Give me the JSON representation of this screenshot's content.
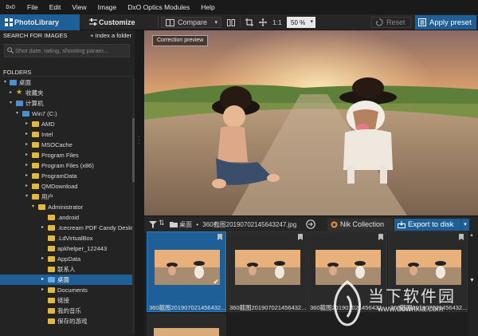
{
  "menubar": {
    "logo": "DxO",
    "items": [
      "File",
      "Edit",
      "View",
      "Image",
      "DxO Optics Modules",
      "Help"
    ]
  },
  "toolbar": {
    "tab_photolibrary": "PhotoLibrary",
    "tab_customize": "Customize",
    "compare": "Compare",
    "zoom_one": "1:1",
    "zoom_value": "50 %",
    "reset": "Reset",
    "apply_preset": "Apply preset"
  },
  "left": {
    "search_header": "SEARCH FOR IMAGES",
    "index_folder": "+ Index a folder",
    "search_placeholder": "Shot date, rating, shooting param...",
    "folders_header": "FOLDERS",
    "tree": [
      {
        "label": "桌面"
      },
      {
        "label": "收藏夹"
      },
      {
        "label": "计算机"
      },
      {
        "label": "Win7 (C:)"
      },
      {
        "label": "AMD"
      },
      {
        "label": "Intel"
      },
      {
        "label": "MSOCache"
      },
      {
        "label": "Program Files"
      },
      {
        "label": "Program Files (x86)"
      },
      {
        "label": "ProgramData"
      },
      {
        "label": "QMDownload"
      },
      {
        "label": "用户"
      },
      {
        "label": "Administrator"
      },
      {
        "label": ".android"
      },
      {
        "label": ".Icecream PDF Candy Deskto"
      },
      {
        "label": ".LdVirtualBox"
      },
      {
        "label": "apkhelper_122443"
      },
      {
        "label": "AppData"
      },
      {
        "label": "联系人"
      },
      {
        "label": "桌面"
      },
      {
        "label": "Documents"
      },
      {
        "label": "链接"
      },
      {
        "label": "我的音乐"
      },
      {
        "label": "保存的游戏"
      }
    ]
  },
  "preview": {
    "label": "Correction preview"
  },
  "strip": {
    "path_root": "桌面",
    "path_sep": "•",
    "path_file": "360截图20190702145643247.jpg",
    "nik": "Nik Collection",
    "export": "Export to disk"
  },
  "thumbs": [
    {
      "caption": "360截图201907021456432..."
    },
    {
      "caption": "360截图201907021456432..."
    },
    {
      "caption": "360截图201907021456432..."
    },
    {
      "caption": "360截图201907021456432..."
    }
  ],
  "watermark": {
    "text": "当下软件园",
    "url": "www.downxia.com"
  },
  "colors": {
    "accent": "#1d5f96",
    "folder": "#e2b840",
    "background": "#1c1c1c"
  }
}
